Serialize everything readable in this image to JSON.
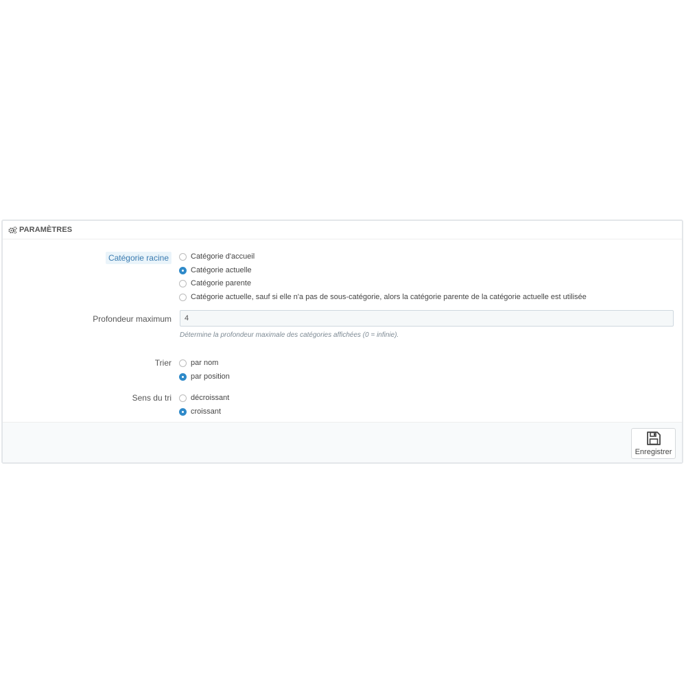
{
  "panel": {
    "title": "PARAMÈTRES",
    "title_icon": "cogs-icon"
  },
  "root_category": {
    "label": "Catégorie racine",
    "options": [
      {
        "label": "Catégorie d'accueil",
        "checked": false
      },
      {
        "label": "Catégorie actuelle",
        "checked": true
      },
      {
        "label": "Catégorie parente",
        "checked": false
      },
      {
        "label": "Catégorie actuelle, sauf si elle n'a pas de sous-catégorie, alors la catégorie parente de la catégorie actuelle est utilisée",
        "checked": false
      }
    ]
  },
  "max_depth": {
    "label": "Profondeur maximum",
    "value": "4",
    "help": "Détermine la profondeur maximale des catégories affichées (0 = infinie)."
  },
  "sort": {
    "label": "Trier",
    "options": [
      {
        "label": "par nom",
        "checked": false
      },
      {
        "label": "par position",
        "checked": true
      }
    ]
  },
  "sort_order": {
    "label": "Sens du tri",
    "options": [
      {
        "label": "décroissant",
        "checked": false
      },
      {
        "label": "croissant",
        "checked": true
      }
    ]
  },
  "footer": {
    "save_label": "Enregistrer",
    "save_icon": "floppy-disk-icon"
  },
  "colors": {
    "accent": "#2f8ac9",
    "label_highlight": "#3a7bb0",
    "panel_border": "#e3e6e9"
  }
}
